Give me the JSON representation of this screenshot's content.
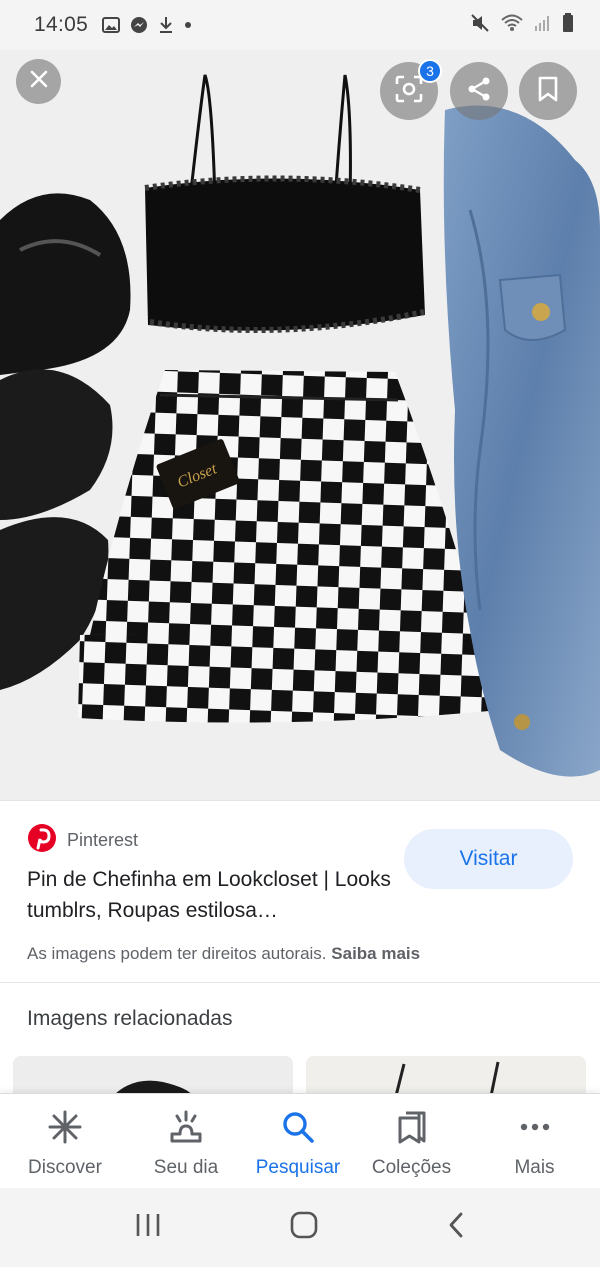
{
  "status_bar": {
    "time": "14:05",
    "left_icons": [
      "image-icon",
      "messenger-icon",
      "download-icon",
      "dot-icon"
    ],
    "right_icons": [
      "mute-icon",
      "wifi-icon",
      "signal-icon",
      "battery-icon"
    ]
  },
  "hero": {
    "close_icon": "close-icon",
    "lens_icon": "lens-icon",
    "lens_badge": "3",
    "share_icon": "share-icon",
    "bookmark_icon": "bookmark-icon",
    "image_brand_text": "Closet"
  },
  "result": {
    "source_name": "Pinterest",
    "title": "Pin de Chefinha em Lookcloset | Looks tumblrs, Roupas estilosa…",
    "visit_label": "Visitar",
    "copyright_text": "As imagens podem ter direitos autorais.",
    "learn_more": "Saiba mais"
  },
  "related": {
    "heading": "Imagens relacionadas"
  },
  "bottom_nav": {
    "items": [
      {
        "label": "Discover",
        "icon": "asterisk-icon",
        "active": false
      },
      {
        "label": "Seu dia",
        "icon": "sunrise-icon",
        "active": false
      },
      {
        "label": "Pesquisar",
        "icon": "search-icon",
        "active": true
      },
      {
        "label": "Coleções",
        "icon": "collections-icon",
        "active": false
      },
      {
        "label": "Mais",
        "icon": "more-icon",
        "active": false
      }
    ]
  },
  "system_nav": [
    "recents-icon",
    "home-icon",
    "back-icon"
  ],
  "colors": {
    "accent": "#1a73e8",
    "visit_bg": "#e8f0fe",
    "pinterest_red": "#e60023"
  }
}
